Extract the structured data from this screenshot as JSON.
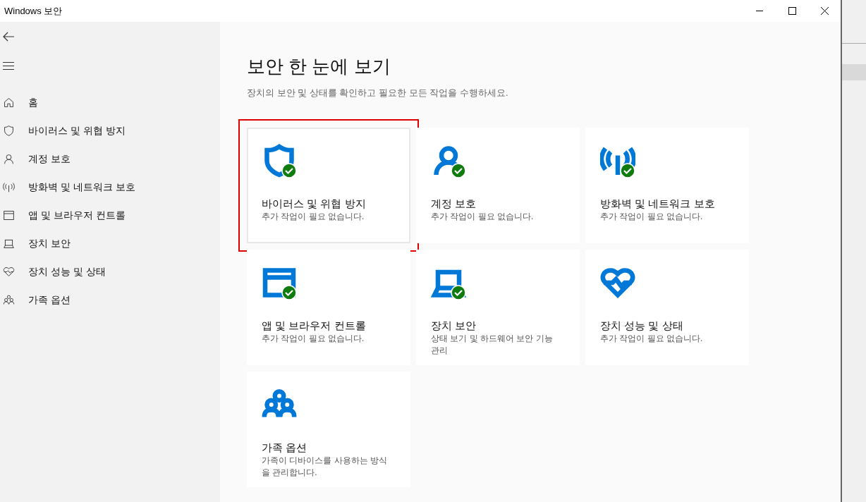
{
  "window": {
    "title": "Windows 보안"
  },
  "sidebar": {
    "items": [
      {
        "kind": "home",
        "label": "홈"
      },
      {
        "kind": "shield",
        "label": "바이러스 및 위협 방지"
      },
      {
        "kind": "person",
        "label": "계정 보호"
      },
      {
        "kind": "antenna",
        "label": "방화벽 및 네트워크 보호"
      },
      {
        "kind": "window",
        "label": "앱 및 브라우저 컨트롤"
      },
      {
        "kind": "laptop",
        "label": "장치 보안"
      },
      {
        "kind": "heart",
        "label": "장치 성능 및 상태"
      },
      {
        "kind": "family",
        "label": "가족 옵션"
      }
    ]
  },
  "main": {
    "heading": "보안 한 눈에 보기",
    "subtitle": "장치의 보안 및 상태를 확인하고 필요한 모든 작업을 수행하세요.",
    "tiles": [
      {
        "kind": "shield",
        "title": "바이러스 및 위협 방지",
        "description": "추가 작업이 필요 없습니다.",
        "ok": true,
        "highlighted": true
      },
      {
        "kind": "person",
        "title": "계정 보호",
        "description": "추가 작업이 필요 없습니다.",
        "ok": true,
        "highlighted": false
      },
      {
        "kind": "antenna",
        "title": "방화벽 및 네트워크 보호",
        "description": "추가 작업이 필요 없습니다.",
        "ok": true,
        "highlighted": false
      },
      {
        "kind": "window",
        "title": "앱 및 브라우저 컨트롤",
        "description": "추가 작업이 필요 없습니다.",
        "ok": true,
        "highlighted": false
      },
      {
        "kind": "laptop",
        "title": "장치 보안",
        "description": "상태 보기 및 하드웨어 보안 기능 관리",
        "ok": true,
        "highlighted": false
      },
      {
        "kind": "heart",
        "title": "장치 성능 및 상태",
        "description": "추가 작업이 필요 없습니다.",
        "ok": false,
        "highlighted": false
      },
      {
        "kind": "family",
        "title": "가족 옵션",
        "description": "가족이 디바이스를 사용하는 방식을 관리합니다.",
        "ok": false,
        "highlighted": false
      }
    ]
  }
}
